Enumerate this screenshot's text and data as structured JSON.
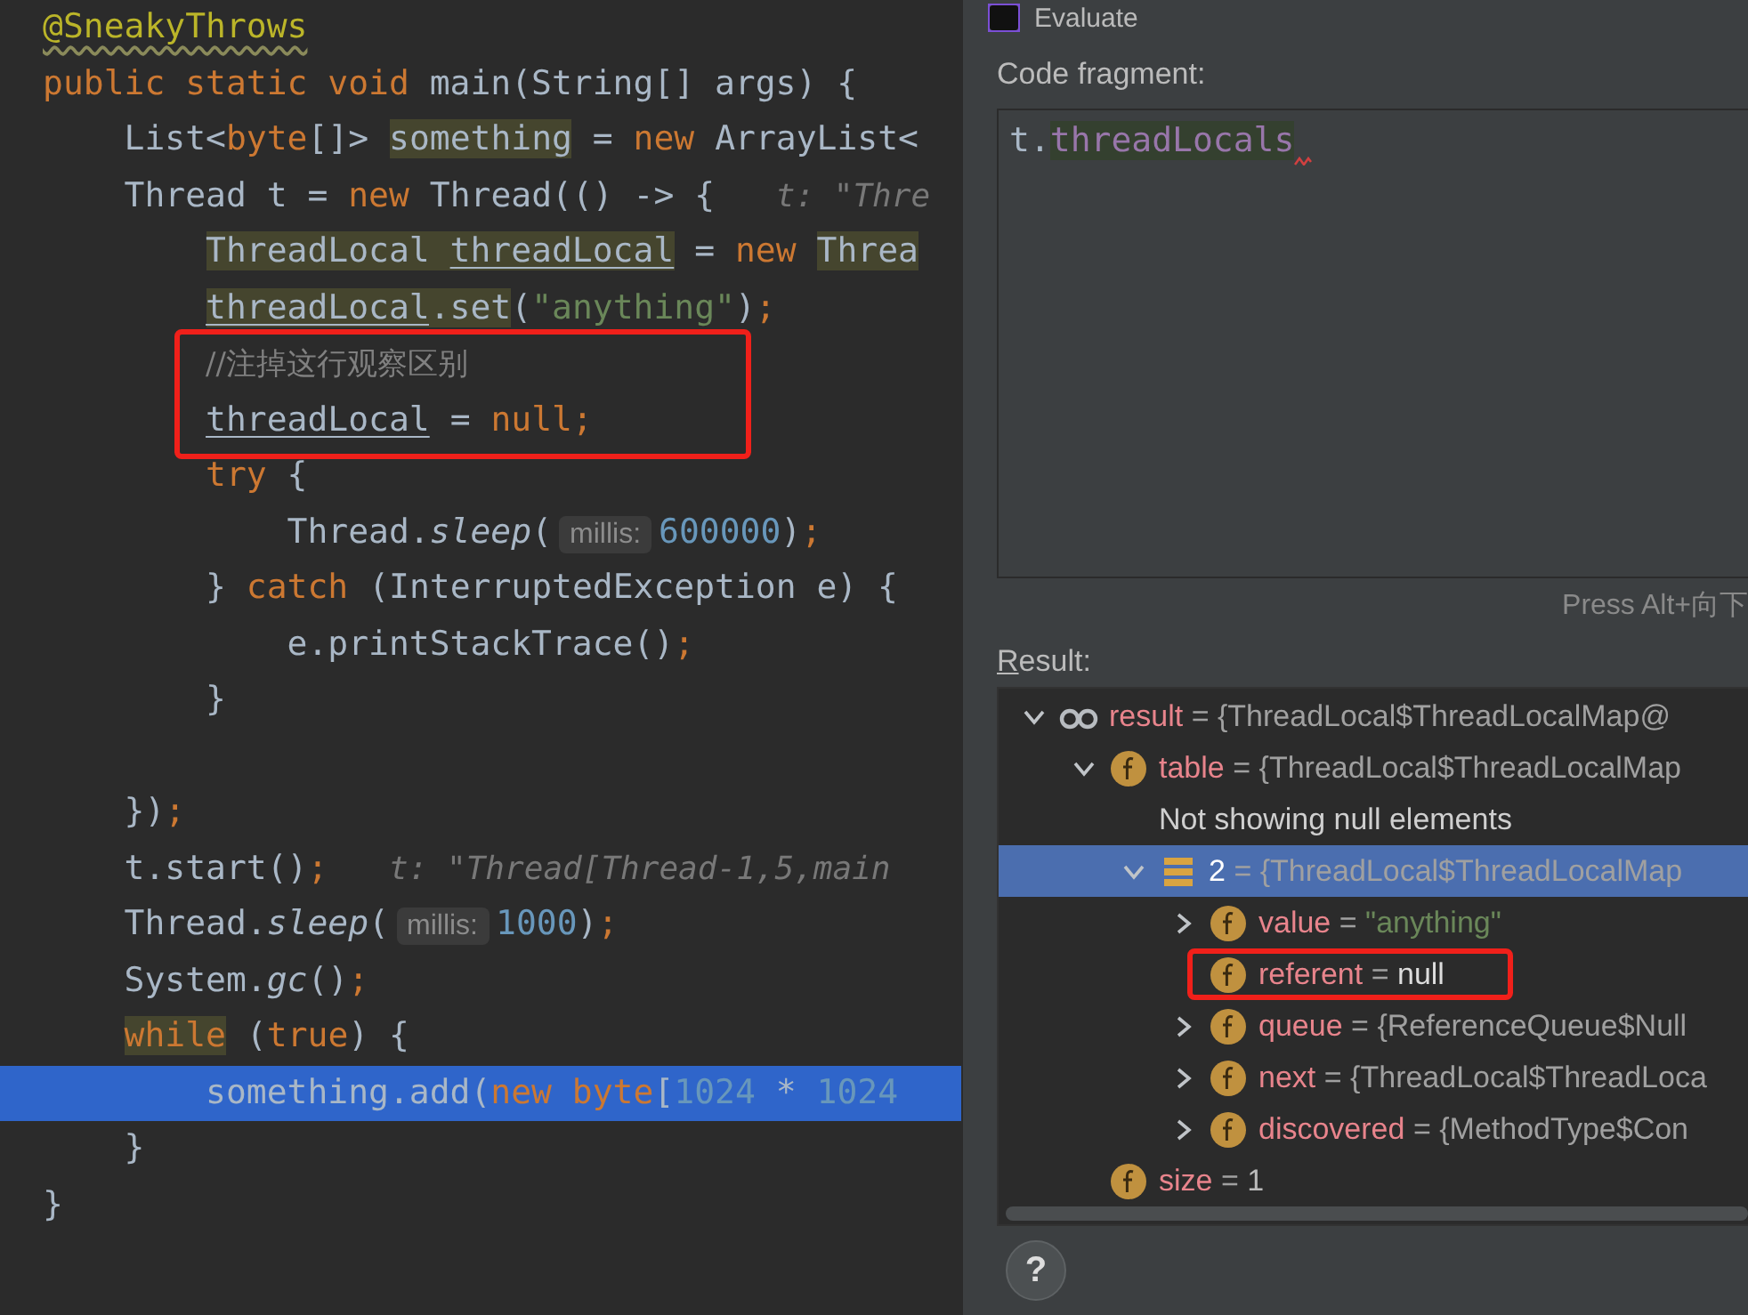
{
  "editor": {
    "lines": [
      {
        "current": false,
        "boxed": false,
        "tokens": [
          {
            "text": "@SneakyThrows",
            "kind": "annotation-warn"
          }
        ]
      },
      {
        "current": false,
        "boxed": false,
        "tokens": [
          {
            "text": "public static void ",
            "kind": "keyword"
          },
          {
            "text": "main(String[] args) {",
            "kind": "plain"
          }
        ]
      },
      {
        "current": false,
        "boxed": false,
        "tokens": [
          {
            "text": "    List<",
            "kind": "plain"
          },
          {
            "text": "byte",
            "kind": "keyword"
          },
          {
            "text": "[]> ",
            "kind": "plain"
          },
          {
            "text": "something",
            "kind": "usage"
          },
          {
            "text": " = ",
            "kind": "plain"
          },
          {
            "text": "new",
            "kind": "keyword"
          },
          {
            "text": " ArrayList<",
            "kind": "plain"
          }
        ]
      },
      {
        "current": false,
        "boxed": false,
        "tokens": [
          {
            "text": "    Thread t = ",
            "kind": "plain"
          },
          {
            "text": "new",
            "kind": "keyword"
          },
          {
            "text": " Thread(() -> {",
            "kind": "plain"
          },
          {
            "text": "   t: \"Thre",
            "kind": "hint"
          }
        ]
      },
      {
        "current": false,
        "boxed": false,
        "tokens": [
          {
            "text": "        ThreadLocal ",
            "kind": "usage"
          },
          {
            "text": "threadLocal",
            "kind": "usage-reassigned"
          },
          {
            "text": " = ",
            "kind": "plain"
          },
          {
            "text": "new ",
            "kind": "keyword"
          },
          {
            "text": "Threa",
            "kind": "usage"
          }
        ]
      },
      {
        "current": false,
        "boxed": false,
        "tokens": [
          {
            "text": "        threadLocal",
            "kind": "usage-reassigned"
          },
          {
            "text": ".set",
            "kind": "usage"
          },
          {
            "text": "(",
            "kind": "plain"
          },
          {
            "text": "\"anything\"",
            "kind": "string"
          },
          {
            "text": ")",
            "kind": "plain"
          },
          {
            "text": ";",
            "kind": "keyword"
          }
        ]
      },
      {
        "current": false,
        "boxed": true,
        "tokens": [
          {
            "text": "        //注掉这行观察区别",
            "kind": "comment"
          }
        ]
      },
      {
        "current": false,
        "boxed": true,
        "tokens": [
          {
            "text": "        threadLocal",
            "kind": "reassigned"
          },
          {
            "text": " = ",
            "kind": "plain"
          },
          {
            "text": "null;",
            "kind": "keyword"
          }
        ]
      },
      {
        "current": false,
        "boxed": false,
        "tokens": [
          {
            "text": "        try",
            "kind": "keyword"
          },
          {
            "text": " {",
            "kind": "plain"
          }
        ]
      },
      {
        "current": false,
        "boxed": false,
        "tokens": [
          {
            "text": "            Thread.",
            "kind": "plain"
          },
          {
            "text": "sleep",
            "kind": "static"
          },
          {
            "text": "(",
            "kind": "plain"
          },
          {
            "text": "millis:",
            "kind": "param-hint"
          },
          {
            "text": "600000",
            "kind": "number"
          },
          {
            "text": ")",
            "kind": "plain"
          },
          {
            "text": ";",
            "kind": "keyword"
          }
        ]
      },
      {
        "current": false,
        "boxed": false,
        "tokens": [
          {
            "text": "        } ",
            "kind": "plain"
          },
          {
            "text": "catch",
            "kind": "keyword"
          },
          {
            "text": " (InterruptedException e) {",
            "kind": "plain"
          }
        ]
      },
      {
        "current": false,
        "boxed": false,
        "tokens": [
          {
            "text": "            e.printStackTrace()",
            "kind": "plain"
          },
          {
            "text": ";",
            "kind": "keyword"
          }
        ]
      },
      {
        "current": false,
        "boxed": false,
        "tokens": [
          {
            "text": "        }",
            "kind": "plain"
          }
        ]
      },
      {
        "kind": "blank",
        "current": false,
        "boxed": false
      },
      {
        "current": false,
        "boxed": false,
        "tokens": [
          {
            "text": "    })",
            "kind": "plain"
          },
          {
            "text": ";",
            "kind": "keyword"
          }
        ]
      },
      {
        "current": false,
        "boxed": false,
        "tokens": [
          {
            "text": "    t.start()",
            "kind": "plain"
          },
          {
            "text": ";",
            "kind": "keyword"
          },
          {
            "text": "   t: \"Thread[Thread-1,5,main",
            "kind": "hint"
          }
        ]
      },
      {
        "current": false,
        "boxed": false,
        "tokens": [
          {
            "text": "    Thread.",
            "kind": "plain"
          },
          {
            "text": "sleep",
            "kind": "static"
          },
          {
            "text": "(",
            "kind": "plain"
          },
          {
            "text": "millis:",
            "kind": "param-hint"
          },
          {
            "text": "1000",
            "kind": "number"
          },
          {
            "text": ")",
            "kind": "plain"
          },
          {
            "text": ";",
            "kind": "keyword"
          }
        ]
      },
      {
        "current": false,
        "boxed": false,
        "tokens": [
          {
            "text": "    System.",
            "kind": "plain"
          },
          {
            "text": "gc",
            "kind": "static"
          },
          {
            "text": "()",
            "kind": "plain"
          },
          {
            "text": ";",
            "kind": "keyword"
          }
        ]
      },
      {
        "current": false,
        "boxed": false,
        "tokens": [
          {
            "text": "    while",
            "kind": "keyword-usage"
          },
          {
            "text": " (",
            "kind": "plain"
          },
          {
            "text": "true",
            "kind": "keyword"
          },
          {
            "text": ") {",
            "kind": "plain"
          }
        ]
      },
      {
        "current": true,
        "boxed": false,
        "tokens": [
          {
            "text": "        something.add(",
            "kind": "plain"
          },
          {
            "text": "new byte",
            "kind": "keyword"
          },
          {
            "text": "[",
            "kind": "plain"
          },
          {
            "text": "1024",
            "kind": "number"
          },
          {
            "text": " * ",
            "kind": "plain"
          },
          {
            "text": "1024",
            "kind": "number"
          }
        ]
      },
      {
        "current": false,
        "boxed": false,
        "tokens": [
          {
            "text": "    }",
            "kind": "plain"
          }
        ]
      },
      {
        "current": false,
        "boxed": false,
        "tokens": [
          {
            "text": "}",
            "kind": "plain"
          }
        ]
      }
    ]
  },
  "dialog": {
    "title": "Evaluate",
    "code_fragment": {
      "label": "Code fragment:",
      "error": true,
      "tokens": [
        {
          "text": "t.",
          "kind": "plain"
        },
        {
          "text": "threadLocals",
          "kind": "member"
        }
      ]
    },
    "hint": "Press Alt+向下",
    "result": {
      "label": "Result:",
      "tree": [
        {
          "kind": "watch",
          "name": "result",
          "sep": "=",
          "value": "{ThreadLocal$ThreadLocalMap@",
          "color": "#a0a0a0",
          "expanded": true,
          "selected": false,
          "boxed": false,
          "children": [
            {
              "kind": "field",
              "name": "table",
              "sep": "=",
              "value": "{ThreadLocal$ThreadLocalMap",
              "color": "#a0a0a0",
              "expanded": true,
              "selected": false,
              "boxed": false,
              "children": [
                {
                  "kind": "message",
                  "text": "Not showing null elements",
                  "selected": false,
                  "boxed": false
                },
                {
                  "kind": "entry",
                  "name": "2",
                  "sep": "=",
                  "value": "{ThreadLocal$ThreadLocalMap",
                  "color": "#a0a0a0",
                  "expanded": true,
                  "selected": true,
                  "boxed": false,
                  "children": [
                    {
                      "kind": "field",
                      "name": "value",
                      "sep": "=",
                      "value": "\"anything\"",
                      "color": "#6a8759",
                      "expanded": false,
                      "selected": false,
                      "boxed": false
                    },
                    {
                      "kind": "field",
                      "name": "referent",
                      "sep": "=",
                      "value": "null",
                      "color": "#dddddd",
                      "selected": false,
                      "boxed": true
                    },
                    {
                      "kind": "field",
                      "name": "queue",
                      "sep": "=",
                      "value": "{ReferenceQueue$Null",
                      "color": "#a0a0a0",
                      "expanded": false,
                      "selected": false,
                      "boxed": false
                    },
                    {
                      "kind": "field",
                      "name": "next",
                      "sep": "=",
                      "value": "{ThreadLocal$ThreadLoca",
                      "color": "#a0a0a0",
                      "expanded": false,
                      "selected": false,
                      "boxed": false
                    },
                    {
                      "kind": "field",
                      "name": "discovered",
                      "sep": "=",
                      "value": "{MethodType$Con",
                      "color": "#a0a0a0",
                      "expanded": false,
                      "selected": false,
                      "boxed": false
                    }
                  ]
                }
              ]
            },
            {
              "kind": "field",
              "name": "size",
              "sep": "=",
              "value": "1",
              "color": "#bbbbbb",
              "selected": false,
              "boxed": false
            }
          ]
        }
      ]
    },
    "help_button": {
      "label": "?"
    }
  }
}
